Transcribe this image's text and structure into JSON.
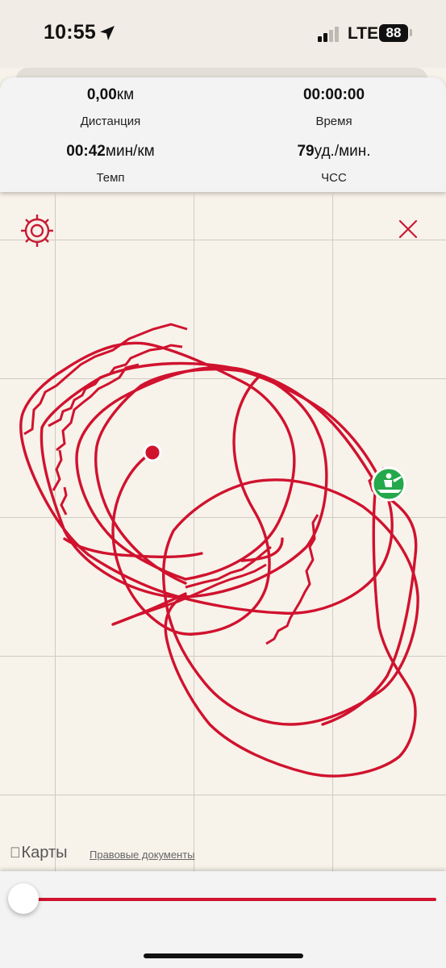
{
  "status_bar": {
    "time": "10:55",
    "carrier": "LTE",
    "battery": "88"
  },
  "stats": {
    "distance": {
      "value": "0,00",
      "unit": "км",
      "label": "Дистанция"
    },
    "time": {
      "value": "00:00:00",
      "label": "Время"
    },
    "pace": {
      "value": "00:42",
      "unit": "мин/км",
      "label": "Темп"
    },
    "heart_rate": {
      "value": "79",
      "unit": "уд./мин.",
      "label": "ЧСС"
    }
  },
  "map": {
    "maps_brand": "Карты",
    "legal_link": "Правовые документы",
    "route_color": "#d0122e",
    "start_marker_color": "#23a94b",
    "end_marker_color": "#d0122e",
    "icons": [
      "gear-icon",
      "close-icon",
      "rowing-boat-icon",
      "apple-logo-icon"
    ]
  },
  "playback": {
    "progress": 0.0,
    "track_color": "#d0122e"
  }
}
